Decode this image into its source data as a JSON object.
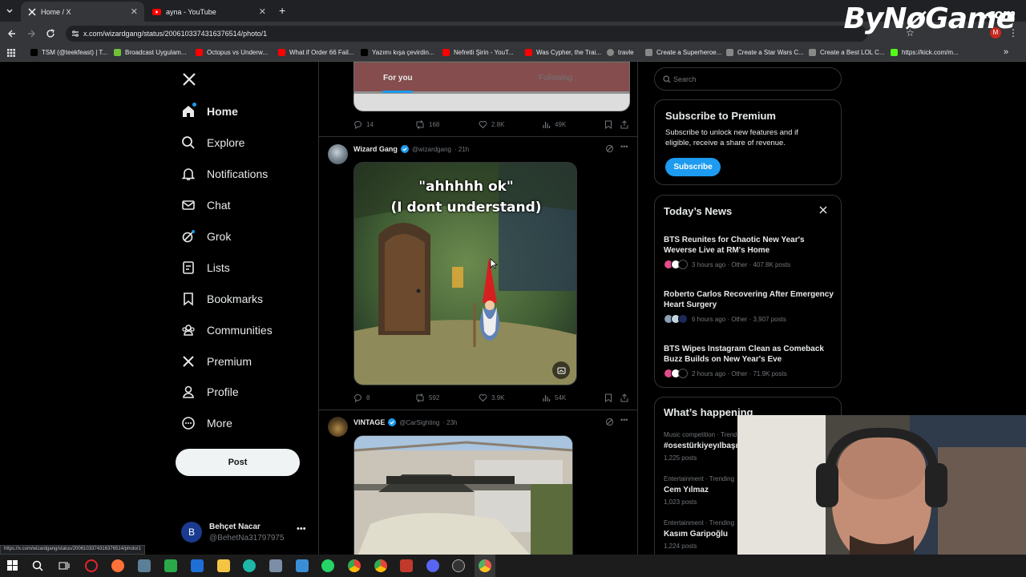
{
  "browser": {
    "tabs": [
      {
        "label": "Home / X",
        "active": true
      },
      {
        "label": "ayna - YouTube",
        "active": false
      }
    ],
    "url": "x.com/wizardgang/status/2006103374316376514/photo/1",
    "bookmarks": [
      {
        "label": "TSM (@teekfeast) | T...",
        "color": "#000000"
      },
      {
        "label": "Broadcast Uygulam...",
        "color": "#6fc236"
      },
      {
        "label": "Octopus vs Underw...",
        "color": "#ff0000"
      },
      {
        "label": "What if Order 66 Fail...",
        "color": "#ff0000"
      },
      {
        "label": "Yazımı kışa çevirdin...",
        "color": "#000000"
      },
      {
        "label": "Nefretli Şirin - YouT...",
        "color": "#ff0000"
      },
      {
        "label": "Was Cypher, the Trai...",
        "color": "#ff0000"
      },
      {
        "label": "travle",
        "color": "#888888"
      },
      {
        "label": "Create a Superheroe...",
        "color": "#888888"
      },
      {
        "label": "Create a Star Wars C...",
        "color": "#888888"
      },
      {
        "label": "Create a Best LOL C...",
        "color": "#888888"
      },
      {
        "label": "https://kick.com/m...",
        "color": "#53fc18"
      }
    ],
    "status_url": "https://x.com/wizardgang/status/2006103374316376514/photo/1"
  },
  "overlay": {
    "logo": "ByNøGame",
    "logo_suffix": ".com"
  },
  "nav": {
    "items": [
      {
        "label": "Home",
        "icon": "home-icon"
      },
      {
        "label": "Explore",
        "icon": "search-icon"
      },
      {
        "label": "Notifications",
        "icon": "bell-icon"
      },
      {
        "label": "Chat",
        "icon": "mail-icon"
      },
      {
        "label": "Grok",
        "icon": "grok-icon"
      },
      {
        "label": "Lists",
        "icon": "list-icon"
      },
      {
        "label": "Bookmarks",
        "icon": "bookmark-icon"
      },
      {
        "label": "Communities",
        "icon": "communities-icon"
      },
      {
        "label": "Premium",
        "icon": "x-icon"
      },
      {
        "label": "Profile",
        "icon": "person-icon"
      },
      {
        "label": "More",
        "icon": "more-icon"
      }
    ],
    "post_label": "Post",
    "user": {
      "name": "Behçet Nacar",
      "handle": "@BehetNa31797975",
      "initial": "B"
    }
  },
  "feed": {
    "tabs": {
      "for_you": "For you",
      "following": "Following"
    },
    "first_metrics": {
      "replies": "14",
      "reposts": "168",
      "likes": "2.8K",
      "views": "49K"
    },
    "tweets": [
      {
        "name": "Wizard Gang",
        "handle": "@wizardgang",
        "time": "· 21h",
        "image_text_1": "\"ahhhhh ok\"",
        "image_text_2": "(I dont understand)",
        "replies": "8",
        "reposts": "592",
        "likes": "3.9K",
        "views": "54K"
      },
      {
        "name": "VINTAGE",
        "handle": "@CarSighting",
        "time": "· 23h"
      }
    ]
  },
  "sidebar": {
    "search_placeholder": "Search",
    "premium": {
      "title": "Subscribe to Premium",
      "body": "Subscribe to unlock new features and if eligible, receive a share of revenue.",
      "button": "Subscribe"
    },
    "news": {
      "title": "Today’s News",
      "items": [
        {
          "headline": "BTS Reunites for Chaotic New Year's Weverse Live at RM's Home",
          "meta": "3 hours ago · Other · 407.8K posts"
        },
        {
          "headline": "Roberto Carlos Recovering After Emergency Heart Surgery",
          "meta": "6 hours ago · Other · 3,907 posts"
        },
        {
          "headline": "BTS Wipes Instagram Clean as Comeback Buzz Builds on New Year's Eve",
          "meta": "2 hours ago · Other · 71.9K posts"
        }
      ]
    },
    "happening": {
      "title": "What’s happening",
      "items": [
        {
          "context": "Music competition · Trending",
          "topic": "#osestürkiyeyılbaşı",
          "posts": "1,225 posts"
        },
        {
          "context": "Entertainment · Trending",
          "topic": "Cem Yılmaz",
          "posts": "1,023 posts"
        },
        {
          "context": "Entertainment · Trending",
          "topic": "Kasım Garipoğlu",
          "posts": "1,224 posts"
        }
      ]
    }
  }
}
